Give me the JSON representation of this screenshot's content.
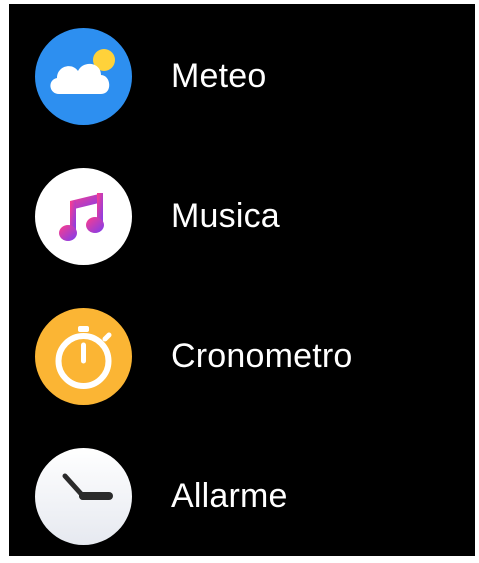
{
  "apps": [
    {
      "label": "Meteo",
      "icon": "weather-icon",
      "color": "#2d8ff0"
    },
    {
      "label": "Musica",
      "icon": "music-note-icon",
      "color": "#ffffff"
    },
    {
      "label": "Cronometro",
      "icon": "stopwatch-icon",
      "color": "#fbb534"
    },
    {
      "label": "Allarme",
      "icon": "clock-icon",
      "color": "#f2f4f8"
    }
  ]
}
